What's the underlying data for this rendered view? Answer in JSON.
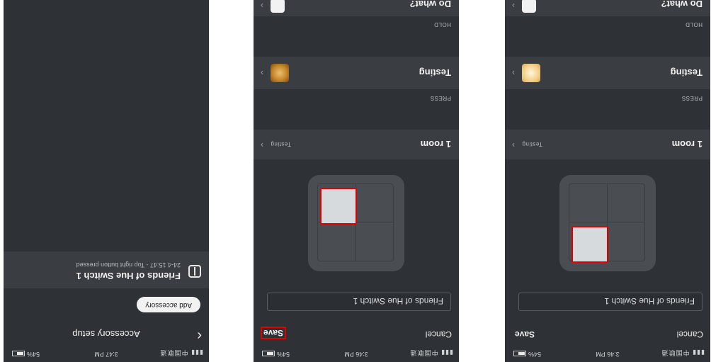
{
  "status_bar": {
    "carrier": "▮▮▮ 中国联通",
    "wifi": "▲",
    "times": [
      "3:47 PM",
      "3:46 PM",
      "3:46 PM"
    ],
    "battery": "54%"
  },
  "screen1": {
    "back_glyph": "‹",
    "title": "Accessory setup",
    "add_button": "Add accessory",
    "accessory": {
      "name": "Friends of Hue Switch 1",
      "subtitle": "24-4 15:47 - Top right button pressed",
      "icon": "switch-icon"
    }
  },
  "screen2": {
    "cancel": "Cancel",
    "save": "Save",
    "name_value": "Friends of Hue Switch 1",
    "room_label": "1 room",
    "room_value": "Testing",
    "press_label": "PRESS",
    "scene_label": "Testing",
    "hold_label": "HOLD",
    "action_label": "Do what?",
    "chevron": "›",
    "pressed_button": "top-left"
  },
  "screen3": {
    "cancel": "Cancel",
    "save": "Save",
    "name_value": "Friends of Hue Switch 1",
    "room_label": "1 room",
    "room_value": "Testing",
    "press_label": "PRESS",
    "scene_label": "Testing",
    "hold_label": "HOLD",
    "action_label": "Do what?",
    "chevron": "›",
    "pressed_button": "bottom-left"
  },
  "colors": {
    "background": "#2e3236",
    "panel": "#3a3e42",
    "highlight": "#e00000",
    "scene_thumb_dark": "#c8862a",
    "scene_thumb_light": "#f2d089"
  }
}
